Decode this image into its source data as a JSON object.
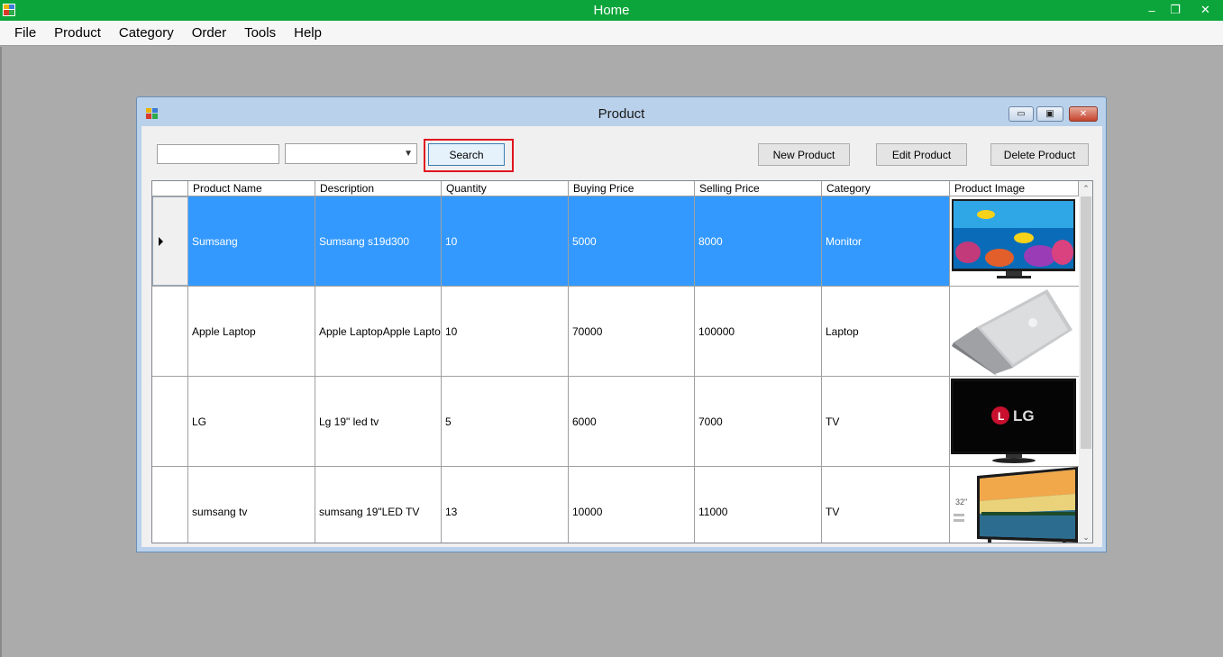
{
  "main_window": {
    "title": "Home",
    "controls": {
      "minimize": "–",
      "maximize": "❐",
      "close": "✕"
    }
  },
  "menu": [
    "File",
    "Product",
    "Category",
    "Order",
    "Tools",
    "Help"
  ],
  "product_window": {
    "title": "Product",
    "controls": {
      "minimize": "▭",
      "maximize": "▣",
      "close": "✕"
    },
    "search_input": {
      "value": ""
    },
    "category_select": {
      "value": ""
    },
    "buttons": {
      "search": "Search",
      "new": "New Product",
      "edit": "Edit Product",
      "delete": "Delete Product"
    },
    "grid": {
      "columns": [
        "Product Name",
        "Description",
        "Quantity",
        "Buying Price",
        "Selling Price",
        "Category",
        "Product Image"
      ],
      "rows": [
        {
          "name": "Sumsang",
          "description": "Sumsang s19d300",
          "quantity": "10",
          "buying_price": "5000",
          "selling_price": "8000",
          "category": "Monitor",
          "image": "monitor-aquarium-image",
          "selected": true
        },
        {
          "name": "Apple Laptop",
          "description": "Apple LaptopApple Lapto…",
          "quantity": "10",
          "buying_price": "70000",
          "selling_price": "100000",
          "category": "Laptop",
          "image": "silver-laptop-image",
          "selected": false
        },
        {
          "name": "LG",
          "description": "Lg 19\" led tv",
          "quantity": "5",
          "buying_price": "6000",
          "selling_price": "7000",
          "category": "TV",
          "image": "lg-tv-image",
          "image_label": "LG",
          "selected": false
        },
        {
          "name": "sumsang tv",
          "description": "sumsang 19\"LED TV",
          "quantity": "13",
          "buying_price": "10000",
          "selling_price": "11000",
          "category": "TV",
          "image": "led-tv-landscape-image",
          "image_label": "32\"",
          "selected": false
        }
      ]
    },
    "scrollbar": {
      "up": "⌃",
      "down": "⌄"
    }
  },
  "colors": {
    "titlebar": "#0ca53b",
    "selection": "#3399ff",
    "highlight_box": "#e0141e"
  }
}
